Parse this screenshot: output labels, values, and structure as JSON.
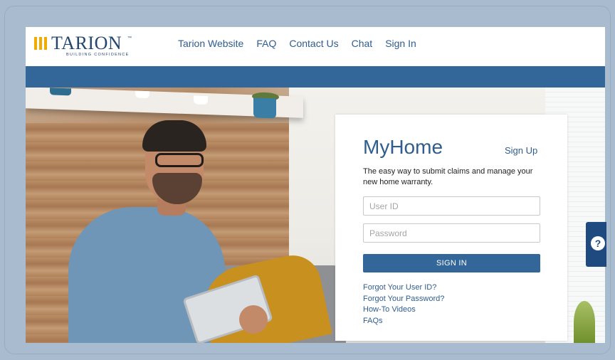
{
  "brand": {
    "name": "TARION",
    "tm": "™",
    "tagline": "BUILDING CONFIDENCE"
  },
  "nav": {
    "items": [
      {
        "label": "Tarion Website"
      },
      {
        "label": "FAQ"
      },
      {
        "label": "Contact Us"
      },
      {
        "label": "Chat"
      },
      {
        "label": "Sign In"
      }
    ]
  },
  "login": {
    "title": "MyHome",
    "signup_label": "Sign Up",
    "description": "The easy way to submit claims and manage your new home warranty.",
    "user_id_placeholder": "User ID",
    "user_id_value": "",
    "password_placeholder": "Password",
    "password_value": "",
    "signin_label": "SIGN IN",
    "links": [
      {
        "label": "Forgot Your User ID?"
      },
      {
        "label": "Forgot Your Password?"
      },
      {
        "label": "How-To Videos"
      },
      {
        "label": "FAQs"
      }
    ]
  },
  "help": {
    "icon": "help-chat-icon",
    "glyph": "?"
  },
  "colors": {
    "brand_blue": "#336699",
    "link_blue": "#2f5d8e",
    "logo_gold": "#f2a900",
    "outer_background": "#a9bccf"
  }
}
